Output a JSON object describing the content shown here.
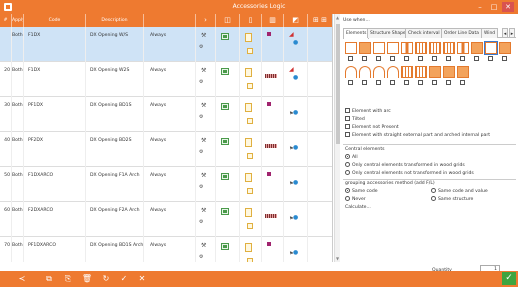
{
  "window": {
    "title": "Accessories Logic",
    "min": "–",
    "max": "□",
    "close": "✕"
  },
  "grid": {
    "headers": {
      "num": "#",
      "apply": "Apply to",
      "code": "Code",
      "description": "Description",
      "when": "",
      "i1": "›"
    },
    "rows": [
      {
        "num": "",
        "apply": "Both",
        "code": "F1DX",
        "description": "DX Opening W/S",
        "when": "Always",
        "selected": true
      },
      {
        "num": "20",
        "apply": "Both",
        "code": "F1DX",
        "description": "DX Opening W2S",
        "when": "Always",
        "selected": false
      },
      {
        "num": "30",
        "apply": "Both",
        "code": "PF1DX",
        "description": "DX Opening BD1S",
        "when": "Always",
        "selected": false
      },
      {
        "num": "40",
        "apply": "Both",
        "code": "PF2DX",
        "description": "DX Opening BD2S",
        "when": "Always",
        "selected": false
      },
      {
        "num": "50",
        "apply": "Both",
        "code": "F1DXARCO",
        "description": "DX Opening F1A Arch",
        "when": "Always",
        "selected": false
      },
      {
        "num": "60",
        "apply": "Both",
        "code": "F2DXARCO",
        "description": "DX Opening F2A Arch",
        "when": "Always",
        "selected": false
      },
      {
        "num": "70",
        "apply": "Both",
        "code": "PF1DXARCO",
        "description": "DX Opening BD1S Arch",
        "when": "Always",
        "selected": false
      }
    ]
  },
  "panel": {
    "use_when": "Use when...",
    "tabs": [
      "Elements",
      "Structure Shape",
      "Check interval",
      "Order Line Data",
      "Wind"
    ],
    "active_tab": "Elements",
    "element_options": [
      "Element with arc",
      "Tilted",
      "Element not Present",
      "Element with straight external part and arched internal part"
    ],
    "central_title": "Central elements",
    "central_options": [
      {
        "label": "All",
        "checked": true
      },
      {
        "label": "Only central elements transformed in wood grids",
        "checked": false
      },
      {
        "label": "Only central elements not transformed in wood grids",
        "checked": false
      }
    ],
    "grouping_title": "grouping accessories method (add F/L)",
    "grouping_options": [
      {
        "label": "Same code",
        "checked": true
      },
      {
        "label": "Same code and value",
        "checked": false
      },
      {
        "label": "Never",
        "checked": false
      },
      {
        "label": "Same structure",
        "checked": false
      }
    ],
    "calculate": "Calculate..."
  },
  "quantity": {
    "label": "Quantity",
    "value": "1"
  },
  "footer": {
    "buttons": [
      "share-icon",
      "copy-icon",
      "paste-icon",
      "delete-icon",
      "refresh-icon",
      "confirm-icon",
      "cancel-icon"
    ],
    "ok": "✓"
  },
  "colors": {
    "accent": "#ee7a30",
    "selected_row": "#cfe3f6",
    "ok": "#3fa43f"
  }
}
